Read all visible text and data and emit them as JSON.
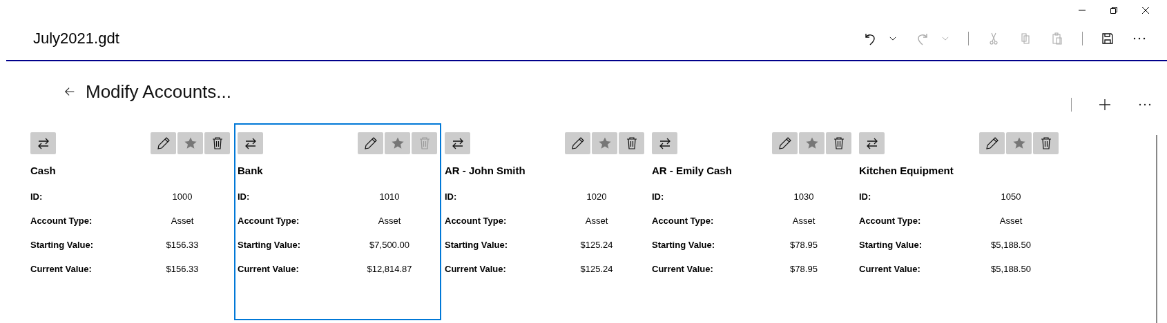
{
  "window": {
    "title": "July2021.gdt"
  },
  "toolbar": [
    {
      "kind": "undo",
      "disabled": false
    },
    {
      "kind": "dropdown",
      "disabled": false
    },
    {
      "kind": "redo",
      "disabled": true
    },
    {
      "kind": "dropdown",
      "disabled": true
    },
    {
      "kind": "separator"
    },
    {
      "kind": "cut",
      "disabled": true
    },
    {
      "kind": "copy",
      "disabled": true
    },
    {
      "kind": "paste",
      "disabled": true
    },
    {
      "kind": "separator"
    },
    {
      "kind": "save",
      "disabled": false
    },
    {
      "kind": "more",
      "disabled": false
    }
  ],
  "page": {
    "title": "Modify Accounts..."
  },
  "accounts": [
    {
      "name": "Cash",
      "selected": false,
      "delete_disabled": false,
      "fields": [
        {
          "label": "ID:",
          "value": "1000"
        },
        {
          "label": "Account Type:",
          "value": "Asset"
        },
        {
          "label": "Starting Value:",
          "value": "$156.33"
        },
        {
          "label": "Current Value:",
          "value": "$156.33"
        }
      ]
    },
    {
      "name": "Bank",
      "selected": true,
      "delete_disabled": true,
      "fields": [
        {
          "label": "ID:",
          "value": "1010"
        },
        {
          "label": "Account Type:",
          "value": "Asset"
        },
        {
          "label": "Starting Value:",
          "value": "$7,500.00"
        },
        {
          "label": "Current Value:",
          "value": "$12,814.87"
        }
      ]
    },
    {
      "name": "AR - John Smith",
      "selected": false,
      "delete_disabled": false,
      "fields": [
        {
          "label": "ID:",
          "value": "1020"
        },
        {
          "label": "Account Type:",
          "value": "Asset"
        },
        {
          "label": "Starting Value:",
          "value": "$125.24"
        },
        {
          "label": "Current Value:",
          "value": "$125.24"
        }
      ]
    },
    {
      "name": "AR - Emily Cash",
      "selected": false,
      "delete_disabled": false,
      "fields": [
        {
          "label": "ID:",
          "value": "1030"
        },
        {
          "label": "Account Type:",
          "value": "Asset"
        },
        {
          "label": "Starting Value:",
          "value": "$78.95"
        },
        {
          "label": "Current Value:",
          "value": "$78.95"
        }
      ]
    },
    {
      "name": "Kitchen Equipment",
      "selected": false,
      "delete_disabled": false,
      "fields": [
        {
          "label": "ID:",
          "value": "1050"
        },
        {
          "label": "Account Type:",
          "value": "Asset"
        },
        {
          "label": "Starting Value:",
          "value": "$5,188.50"
        },
        {
          "label": "Current Value:",
          "value": "$5,188.50"
        }
      ]
    }
  ]
}
